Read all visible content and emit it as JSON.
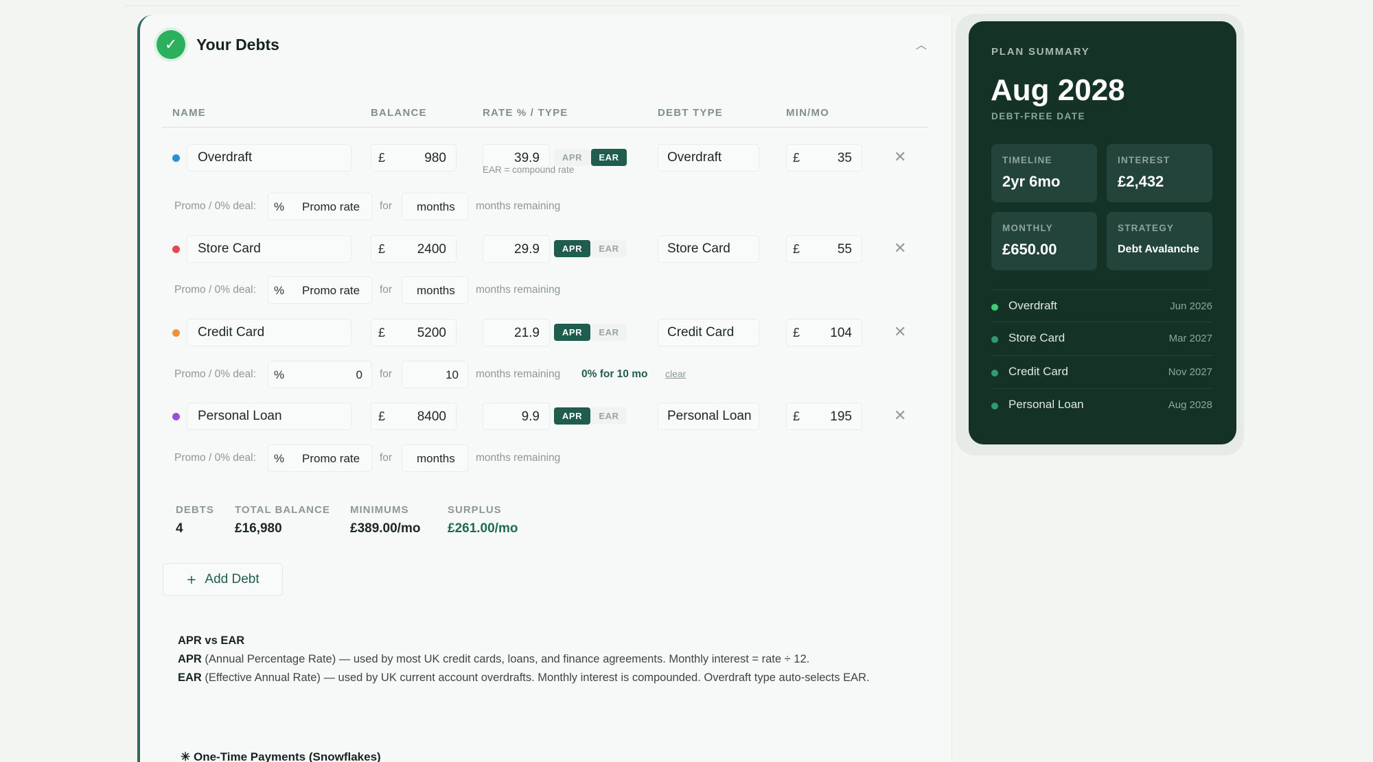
{
  "section": {
    "title": "Your Debts",
    "columns": [
      "NAME",
      "BALANCE",
      "RATE % / TYPE",
      "DEBT TYPE",
      "MIN/MO"
    ]
  },
  "debts": [
    {
      "color": "#2b8fd8",
      "name": "Overdraft",
      "currency": "£",
      "balance": "980",
      "rate": "39.9",
      "apr_label": "APR",
      "ear_label": "EAR",
      "active": "EAR",
      "note": "EAR = compound rate",
      "debt_type": "Overdraft",
      "min": "35",
      "promo": {
        "label": "Promo / 0% deal:",
        "pct": "%",
        "rate_placeholder": "Promo rate",
        "for": "for",
        "months_placeholder": "months",
        "remaining": "months remaining"
      }
    },
    {
      "color": "#e5484d",
      "name": "Store Card",
      "currency": "£",
      "balance": "2400",
      "rate": "29.9",
      "apr_label": "APR",
      "ear_label": "EAR",
      "active": "APR",
      "debt_type": "Store Card",
      "min": "55",
      "promo": {
        "label": "Promo / 0% deal:",
        "pct": "%",
        "rate_placeholder": "Promo rate",
        "for": "for",
        "months_placeholder": "months",
        "remaining": "months remaining"
      }
    },
    {
      "color": "#f0913a",
      "name": "Credit Card",
      "currency": "£",
      "balance": "5200",
      "rate": "21.9",
      "apr_label": "APR",
      "ear_label": "EAR",
      "active": "APR",
      "debt_type": "Credit Card",
      "min": "104",
      "promo": {
        "label": "Promo / 0% deal:",
        "pct": "%",
        "rate_value": "0",
        "for": "for",
        "months_value": "10",
        "remaining": "months remaining",
        "note": "0% for 10 mo",
        "clear": "clear"
      }
    },
    {
      "color": "#9b4fd6",
      "name": "Personal Loan",
      "currency": "£",
      "balance": "8400",
      "rate": "9.9",
      "apr_label": "APR",
      "ear_label": "EAR",
      "active": "APR",
      "debt_type": "Personal Loan",
      "min": "195",
      "promo": {
        "label": "Promo / 0% deal:",
        "pct": "%",
        "rate_placeholder": "Promo rate",
        "for": "for",
        "months_placeholder": "months",
        "remaining": "months remaining"
      }
    }
  ],
  "stats": {
    "debts_label": "DEBTS",
    "debts_value": "4",
    "balance_label": "TOTAL BALANCE",
    "balance_value": "£16,980",
    "min_label": "MINIMUMS",
    "min_value": "£389.00/mo",
    "surplus_label": "SURPLUS",
    "surplus_value": "£261.00/mo"
  },
  "add_button": {
    "plus": "+",
    "label": "Add Debt"
  },
  "info": {
    "title": "APR vs EAR",
    "apr_term": "APR",
    "apr_text": " (Annual Percentage Rate) — used by most UK credit cards, loans, and finance agreements. Monthly interest = rate ÷ 12.",
    "ear_term": "EAR",
    "ear_text": " (Effective Annual Rate) — used by UK current account overdrafts. Monthly interest is compounded. Overdraft type auto-selects EAR."
  },
  "snowflakes": {
    "icon": "✳",
    "title": "One-Time Payments (Snowflakes)"
  },
  "summary": {
    "label": "PLAN SUMMARY",
    "date": "Aug 2028",
    "sub": "DEBT-FREE DATE",
    "tiles": [
      {
        "label": "TIMELINE",
        "value": "2yr 6mo"
      },
      {
        "label": "INTEREST",
        "value": "£2,432"
      },
      {
        "label": "MONTHLY",
        "value": "£650.00"
      },
      {
        "label": "STRATEGY",
        "value": "Debt Avalanche"
      }
    ],
    "payoffs": [
      {
        "name": "Overdraft",
        "date": "Jun 2026",
        "color": "#3ecf6e"
      },
      {
        "name": "Store Card",
        "date": "Mar 2027",
        "color": "#2f9a73"
      },
      {
        "name": "Credit Card",
        "date": "Nov 2027",
        "color": "#2f9a73"
      },
      {
        "name": "Personal Loan",
        "date": "Aug 2028",
        "color": "#2f9a73"
      }
    ]
  },
  "icons": {
    "check": "check-icon",
    "collapse": "chevron-up-icon",
    "remove": "close-icon"
  }
}
